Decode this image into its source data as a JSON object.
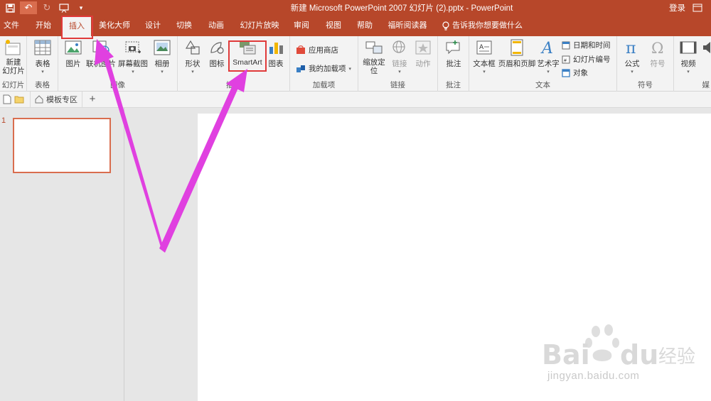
{
  "titlebar": {
    "title": "新建 Microsoft PowerPoint 2007 幻灯片 (2).pptx  -  PowerPoint",
    "login": "登录",
    "qat_more": "▾"
  },
  "tabs": [
    {
      "label": "文件"
    },
    {
      "label": "开始"
    },
    {
      "label": "插入"
    },
    {
      "label": "美化大师"
    },
    {
      "label": "设计"
    },
    {
      "label": "切换"
    },
    {
      "label": "动画"
    },
    {
      "label": "幻灯片放映"
    },
    {
      "label": "审阅"
    },
    {
      "label": "视图"
    },
    {
      "label": "帮助"
    },
    {
      "label": "福昕阅读器"
    }
  ],
  "tellme": "告诉我你想要做什么",
  "ribbon": {
    "slides": {
      "new_slide": "新建\n幻灯片",
      "label": "幻灯片"
    },
    "tables": {
      "table": "表格",
      "label": "表格"
    },
    "images": {
      "picture": "图片",
      "online_picture": "联机图片",
      "screenshot": "屏幕截图",
      "album": "相册",
      "label": "图像"
    },
    "illustrations": {
      "shapes": "形状",
      "icons": "图标",
      "smartart": "SmartArt",
      "chart": "图表",
      "label": "插图"
    },
    "addins": {
      "store": "应用商店",
      "my_addins": "我的加载项",
      "label": "加载项"
    },
    "links": {
      "zoom": "缩放定\n位",
      "link": "链接",
      "action": "动作",
      "label": "链接"
    },
    "comments": {
      "comment": "批注",
      "label": "批注"
    },
    "text": {
      "textbox": "文本框",
      "header_footer": "页眉和页脚",
      "wordart": "艺术字",
      "datetime": "日期和时间",
      "slide_number": "幻灯片编号",
      "object": "对象",
      "label": "文本"
    },
    "symbols": {
      "equation": "公式",
      "symbol": "符号",
      "label": "符号"
    },
    "media": {
      "video": "视频",
      "label": "媒"
    }
  },
  "quickbar": {
    "templates": "模板专区",
    "add": "+"
  },
  "slides_pane": {
    "number": "1"
  },
  "watermark": {
    "url": "jingyan.baidu.com"
  },
  "colors": {
    "accent": "#b7472a",
    "highlight": "#e03a3a",
    "arrow": "#e040e0"
  }
}
